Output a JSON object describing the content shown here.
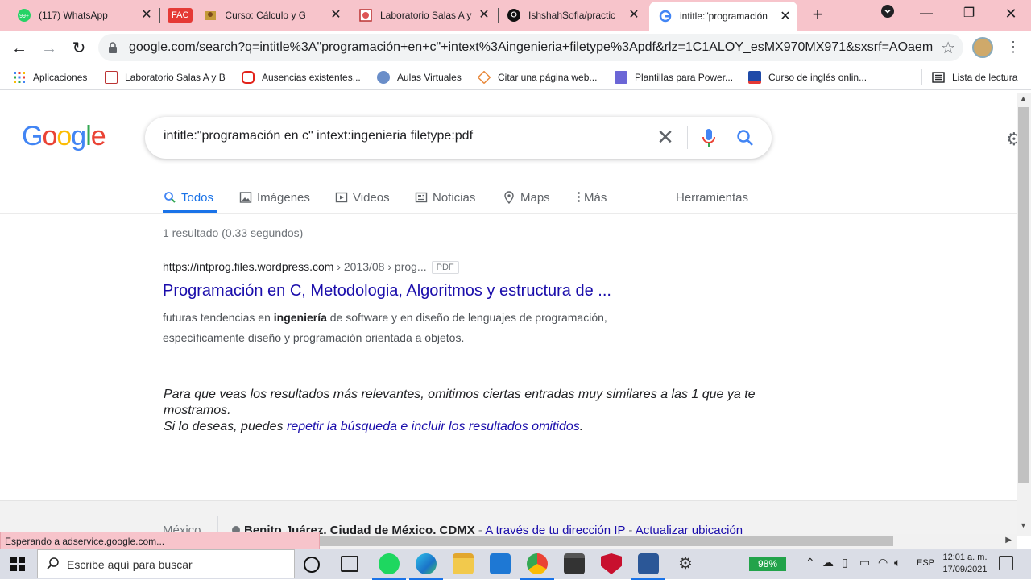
{
  "browser": {
    "tabs": [
      {
        "title": "(117) WhatsApp",
        "favicon": "whatsapp-icon"
      },
      {
        "title": "FAC",
        "favicon": "fac-badge"
      },
      {
        "title": "Curso: Cálculo y Geo",
        "favicon": "course-icon"
      },
      {
        "title": "Laboratorio Salas A y",
        "favicon": "lab-icon"
      },
      {
        "title": "IshshahSofia/practic",
        "favicon": "github-icon"
      },
      {
        "title": "intitle:\"programación",
        "favicon": "google-icon"
      }
    ],
    "fac_label": "FAC",
    "url": "google.com/search?q=intitle%3A\"programación+en+c\"+intext%3Aingenieria+filetype%3Apdf&rlz=1C1ALOY_esMX970MX971&sxsrf=AOaem...",
    "bookmarks": [
      "Aplicaciones",
      "Laboratorio Salas A y B",
      "Ausencias existentes...",
      "Aulas Virtuales",
      "Citar una página web...",
      "Plantillas para Power...",
      "Curso de inglés onlin...",
      "Lista de lectura"
    ]
  },
  "google": {
    "logo": [
      "G",
      "o",
      "o",
      "g",
      "l",
      "e"
    ],
    "query": "intitle:\"programación en c\" intext:ingenieria filetype:pdf",
    "tabs": [
      "Todos",
      "Imágenes",
      "Videos",
      "Noticias",
      "Maps",
      "Más"
    ],
    "tools": "Herramientas",
    "stats": "1 resultado (0.33 segundos)",
    "result": {
      "cite_domain": "https://intprog.files.wordpress.com",
      "cite_path": " › 2013/08 › prog...",
      "badge": "PDF",
      "title": "Programación en C, Metodologia, Algoritmos y estructura de ...",
      "snippet_pre": "futuras tendencias en ",
      "snippet_bold": "ingeniería",
      "snippet_post": " de software y en diseño de lenguajes de programación, específicamente diseño y programación orientada a objetos."
    },
    "omitted": {
      "line1": "Para que veas los resultados más relevantes, omitimos ciertas entradas muy similares a las 1 que ya te mostramos.",
      "line2_pre": "Si lo deseas, puedes ",
      "line2_link": "repetir la búsqueda e incluir los resultados omitidos",
      "line2_post": "."
    },
    "footer": {
      "country": "México",
      "location": "Benito Juárez, Ciudad de México, CDMX",
      "via": "A través de tu dirección IP",
      "update": "Actualizar ubicación",
      "dash": " - "
    }
  },
  "status_bar": "Esperando a adservice.google.com...",
  "taskbar": {
    "search_placeholder": "Escribe aquí para buscar",
    "battery": "98%",
    "lang": "ESP",
    "time": "12:01 a. m.",
    "date": "17/09/2021"
  },
  "colors": {
    "tab_bar": "#f7c4cb",
    "link": "#1a0dab",
    "google_blue": "#4285f4",
    "google_red": "#ea4335",
    "google_yellow": "#fbbc05",
    "google_green": "#34a853"
  }
}
